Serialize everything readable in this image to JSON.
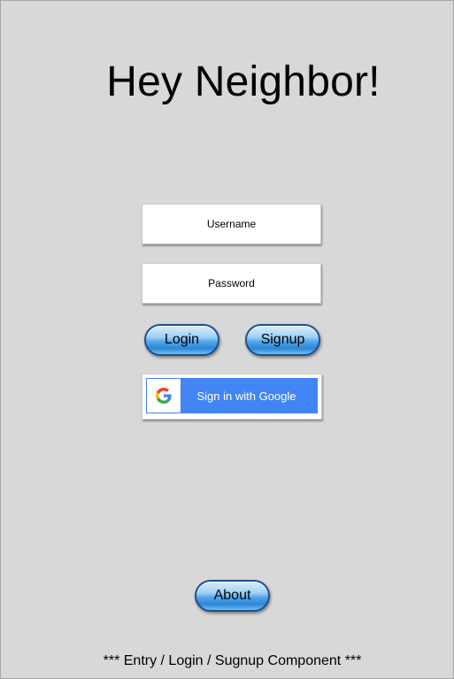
{
  "header": {
    "title": "Hey Neighbor!"
  },
  "form": {
    "username_placeholder": "Username",
    "password_placeholder": "Password",
    "login_label": "Login",
    "signup_label": "Signup",
    "google_label": "Sign in with Google"
  },
  "footer": {
    "about_label": "About",
    "caption": "*** Entry / Login / Sugnup Component ***"
  },
  "icons": {
    "google": "google-g-logo"
  },
  "colors": {
    "background": "#d8d8d8",
    "google_blue": "#4285f4",
    "pill_border": "#1d4f8f"
  }
}
